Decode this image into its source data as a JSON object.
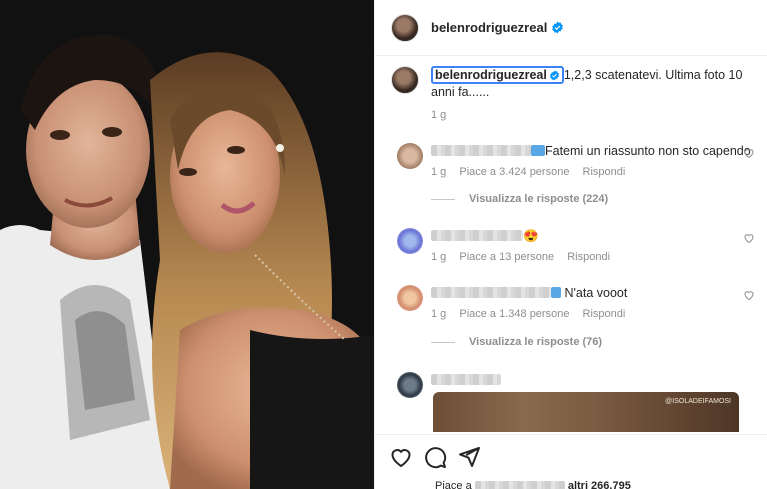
{
  "post": {
    "username": "belenrodriguezreal",
    "verified": true
  },
  "caption": {
    "username": "belenrodriguezreal",
    "text": "1,2,3 scatenatevi. Ultima foto 10 anni fa......",
    "time": "1 g"
  },
  "comments": [
    {
      "text": "Fatemi un riassunto non sto capendo",
      "time": "1 g",
      "likes": "Piace a 3.424 persone",
      "reply_label": "Rispondi",
      "view_replies": "Visualizza le risposte (224)"
    },
    {
      "text": "😍",
      "time": "1 g",
      "likes": "Piace a 13 persone",
      "reply_label": "Rispondi"
    },
    {
      "text": "N'ata vooot",
      "time": "1 g",
      "likes": "Piace a 1.348 persone",
      "reply_label": "Rispondi",
      "view_replies": "Visualizza le risposte (76)"
    }
  ],
  "embed": {
    "tag": "@ISOLADEIFAMOSI"
  },
  "actions": {
    "icons": [
      "heart-outline-icon",
      "comment-bubble-icon",
      "share-paper-plane-icon"
    ],
    "likes_prefix": "Piace a",
    "likes_suffix": "altri 266.795"
  },
  "colors": {
    "accent": "#0095f6",
    "highlight_border": "#3b82f6",
    "muted_text": "#8e8e8e"
  }
}
